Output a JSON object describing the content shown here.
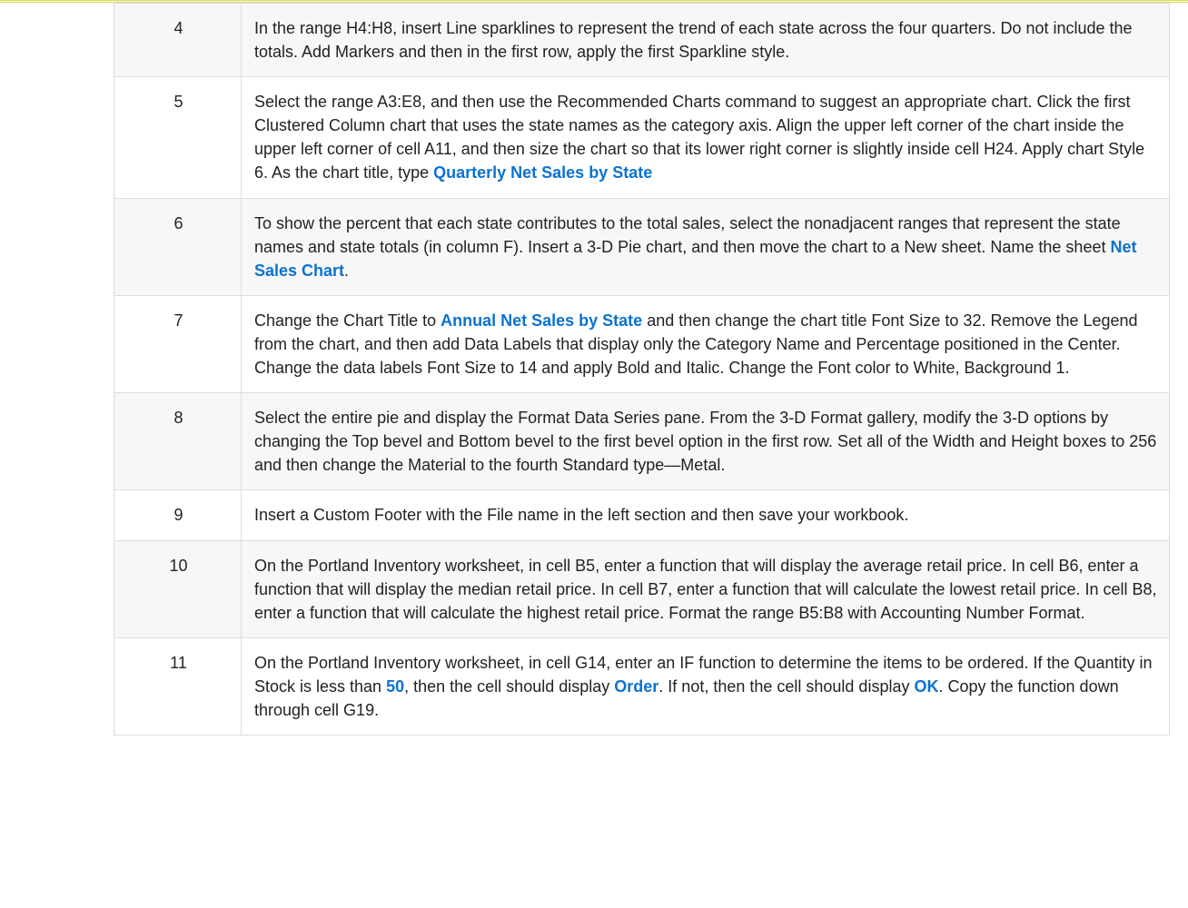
{
  "rows": [
    {
      "num": "4",
      "shade": true,
      "segments": [
        {
          "t": "In the range H4:H8, insert Line sparklines to represent the trend of each state across the four quarters. Do not include the totals. Add Markers and then in the first row, apply the first Sparkline style."
        }
      ]
    },
    {
      "num": "5",
      "shade": false,
      "segments": [
        {
          "t": "Select the range A3:E8, and then use the Recommended Charts command to suggest an appropriate chart. Click the first Clustered Column chart that uses the state names as the category axis. Align the upper left corner of the chart inside the upper left corner of cell A11, and then size the chart so that its lower right corner is slightly inside cell H24. Apply chart Style 6. As the chart title, type "
        },
        {
          "t": "Quarterly Net Sales by State",
          "hlt": true
        }
      ]
    },
    {
      "num": "6",
      "shade": true,
      "segments": [
        {
          "t": "To show the percent that each state contributes to the total sales, select the nonadjacent ranges that represent the state names and state totals (in column F). Insert a 3-D Pie chart, and then move the chart to a New sheet. Name the sheet "
        },
        {
          "t": "Net Sales Chart",
          "hlt": true
        },
        {
          "t": "."
        }
      ]
    },
    {
      "num": "7",
      "shade": false,
      "segments": [
        {
          "t": "Change the Chart Title to "
        },
        {
          "t": "Annual Net Sales by State",
          "hlt": true
        },
        {
          "t": " and then change the chart title Font Size to 32. Remove the Legend from the chart, and then add Data Labels that display only the Category Name and Percentage positioned in the Center. Change the data labels Font Size to 14 and apply Bold and Italic. Change the Font color to White, Background 1."
        }
      ]
    },
    {
      "num": "8",
      "shade": true,
      "segments": [
        {
          "t": "Select the entire pie and display the Format Data Series pane. From the 3-D Format gallery, modify the 3-D options by changing the Top bevel and Bottom bevel to the first bevel option in the first row. Set all of the Width and Height boxes to 256 and then change the Material to the fourth Standard type—Metal."
        }
      ]
    },
    {
      "num": "9",
      "shade": false,
      "segments": [
        {
          "t": "Insert a Custom Footer with the File name in the left section and then save your workbook."
        }
      ]
    },
    {
      "num": "10",
      "shade": true,
      "segments": [
        {
          "t": "On the Portland Inventory worksheet, in cell B5, enter a function that will display the average retail price. In cell B6, enter a function that will display the median retail price. In cell B7, enter a function that will calculate the lowest retail price. In cell B8, enter a function that will calculate the highest retail price. Format the range B5:B8 with Accounting Number Format."
        }
      ]
    },
    {
      "num": "11",
      "shade": false,
      "segments": [
        {
          "t": "On the Portland Inventory worksheet, in cell G14, enter an IF function to determine the items to be ordered. If the Quantity in Stock is less than "
        },
        {
          "t": "50",
          "hlt": true
        },
        {
          "t": ", then the cell should display "
        },
        {
          "t": "Order",
          "hlt": true
        },
        {
          "t": ". If not, then the cell should display "
        },
        {
          "t": "OK",
          "hlt": true
        },
        {
          "t": ". Copy the function down through cell G19."
        }
      ]
    }
  ]
}
